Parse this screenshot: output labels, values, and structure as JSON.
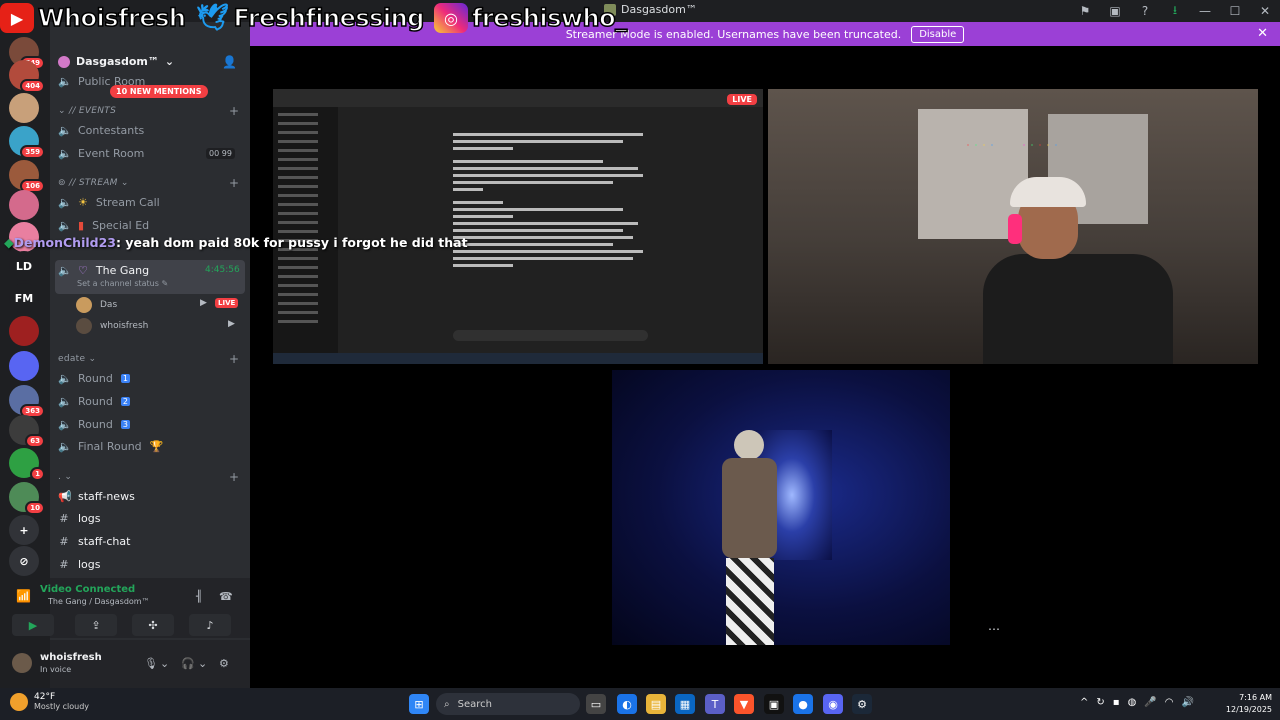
{
  "window": {
    "title": "Dasgasdom™"
  },
  "social_overlay": {
    "youtube": "Whoisfresh",
    "twitter": "Freshfinessing",
    "instagram": "freshiswho_"
  },
  "banner": {
    "text": "Streamer Mode is enabled. Usernames have been truncated.",
    "disable_label": "Disable"
  },
  "servers": [
    {
      "icon": "avatar",
      "badge": "549",
      "color": "#7a4a3a"
    },
    {
      "icon": "avatar",
      "badge": "404",
      "color": "#b24b3c"
    },
    {
      "icon": "avatar",
      "badge": "",
      "color": "#c8a07a"
    },
    {
      "icon": "avatar",
      "badge": "359",
      "color": "#3aa3c9"
    },
    {
      "icon": "avatar",
      "badge": "106",
      "color": "#9b5a3c"
    },
    {
      "icon": "avatar",
      "badge": "",
      "color": "#d46a8c"
    },
    {
      "icon": "avatar",
      "badge": "",
      "color": "#e97fa0"
    },
    {
      "label": "LD",
      "badge": "",
      "color": "#1e1f22"
    },
    {
      "label": "FM",
      "badge": "",
      "color": "#1e1f22"
    },
    {
      "icon": "avatar",
      "badge": "",
      "color": "#9e2020"
    },
    {
      "icon": "folder-icon",
      "badge": "",
      "color": "#5865f2"
    },
    {
      "icon": "avatar",
      "badge": "363",
      "color": "#5a6ea3"
    },
    {
      "icon": "avatar",
      "badge": "63",
      "color": "#3c3c3c"
    },
    {
      "icon": "avatar",
      "badge": "1",
      "color": "#2ea043"
    },
    {
      "icon": "avatar",
      "badge": "10",
      "color": "#4e8b57"
    },
    {
      "icon": "add-server-icon",
      "label": "+",
      "badge": "",
      "color": "#313338"
    },
    {
      "icon": "discover-icon",
      "label": "⊘",
      "badge": "",
      "color": "#313338"
    }
  ],
  "sidebar": {
    "server_name": "Dasgasdom™",
    "new_mentions": "10 NEW MENTIONS",
    "partial_channel": "Public Room",
    "categories": {
      "events": "// Events",
      "stream": "// STREAM",
      "edate": "edate",
      "dot": "."
    },
    "channels": {
      "contestants": "Contestants",
      "event_room": "Event Room",
      "event_room_count_a": "00",
      "event_room_count_b": "99",
      "stream_call": "Stream Call",
      "special_ed": "Special Ed",
      "the_gang": "The Gang",
      "the_gang_timer": "4:45:56",
      "status_prompt": "Set a channel status",
      "round1": "Round",
      "round2": "Round",
      "round3": "Round",
      "final_round": "Final Round",
      "staff_news": "staff-news",
      "logs1": "logs",
      "staff_chat": "staff-chat",
      "logs2": "logs"
    },
    "members": [
      {
        "name": "Das",
        "live": "LIVE"
      },
      {
        "name": "whoisfresh"
      }
    ]
  },
  "chat_overlay": {
    "user": "DemonChild23",
    "message": ": yeah dom paid 80k for pussy i forgot he did that"
  },
  "voice": {
    "status": "Video Connected",
    "location": "The Gang / Dasgasdom™"
  },
  "user_panel": {
    "name": "whoisfresh",
    "status": "In voice"
  },
  "stage": {
    "live_label": "LIVE",
    "more_label": "⋯"
  },
  "taskbar": {
    "temp": "42°F",
    "condition": "Mostly cloudy",
    "search_label": "Search",
    "time": "7:16 AM",
    "date": "12/19/2025"
  }
}
